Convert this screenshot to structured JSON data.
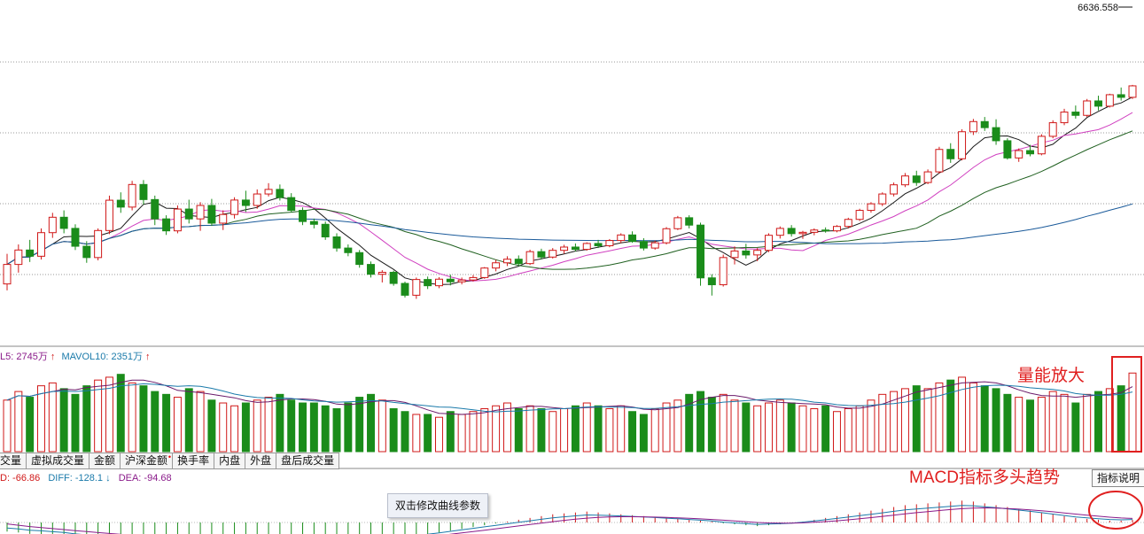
{
  "chart_data": {
    "type": "candlestick",
    "price_top_label": "6636.558",
    "volume_header": {
      "mavol5": "L5: 2745万",
      "mavol5_arrow": "↑",
      "mavol10": "MAVOL10: 2351万",
      "mavol10_arrow": "↑"
    },
    "macd_header": {
      "macd": "D: -66.86",
      "diff": "DIFF: -128.1",
      "diff_arrow": "↓",
      "dea": "DEA: -94.68"
    },
    "colors": {
      "up": "#d01818",
      "down": "#1a8c1a",
      "ma5": "#1a1a1a",
      "ma10": "#d040c0",
      "ma20": "#206020",
      "ma60": "#1a5a9a",
      "vol_ma5": "#6a1a6a",
      "vol_ma10": "#1a7aaa",
      "annotation": "#e02020"
    },
    "candles_note": "daily candles; O,H,L,C in index points",
    "candles": [
      [
        5021,
        5205,
        4982,
        5140
      ],
      [
        5140,
        5262,
        5090,
        5228
      ],
      [
        5228,
        5290,
        5155,
        5190
      ],
      [
        5190,
        5360,
        5170,
        5334
      ],
      [
        5334,
        5455,
        5302,
        5428
      ],
      [
        5428,
        5470,
        5330,
        5360
      ],
      [
        5360,
        5385,
        5228,
        5251
      ],
      [
        5251,
        5282,
        5150,
        5182
      ],
      [
        5182,
        5360,
        5165,
        5347
      ],
      [
        5347,
        5560,
        5325,
        5532
      ],
      [
        5532,
        5580,
        5455,
        5490
      ],
      [
        5490,
        5650,
        5470,
        5628
      ],
      [
        5628,
        5655,
        5505,
        5536
      ],
      [
        5536,
        5560,
        5380,
        5418
      ],
      [
        5418,
        5440,
        5320,
        5345
      ],
      [
        5345,
        5500,
        5330,
        5478
      ],
      [
        5478,
        5535,
        5390,
        5418
      ],
      [
        5418,
        5520,
        5345,
        5500
      ],
      [
        5500,
        5540,
        5375,
        5392
      ],
      [
        5392,
        5470,
        5350,
        5445
      ],
      [
        5445,
        5550,
        5420,
        5533
      ],
      [
        5533,
        5590,
        5460,
        5500
      ],
      [
        5500,
        5598,
        5480,
        5570
      ],
      [
        5570,
        5636,
        5555,
        5598
      ],
      [
        5598,
        5628,
        5530,
        5548
      ],
      [
        5548,
        5575,
        5458,
        5470
      ],
      [
        5470,
        5488,
        5380,
        5402
      ],
      [
        5402,
        5420,
        5360,
        5385
      ],
      [
        5385,
        5402,
        5290,
        5308
      ],
      [
        5308,
        5330,
        5218,
        5240
      ],
      [
        5240,
        5262,
        5190,
        5212
      ],
      [
        5212,
        5228,
        5120,
        5140
      ],
      [
        5140,
        5158,
        5060,
        5080
      ],
      [
        5080,
        5105,
        5030,
        5092
      ],
      [
        5092,
        5102,
        5010,
        5024
      ],
      [
        5024,
        5035,
        4938,
        4952
      ],
      [
        4952,
        5060,
        4930,
        5048
      ],
      [
        5048,
        5066,
        4990,
        5010
      ],
      [
        5010,
        5062,
        4995,
        5050
      ],
      [
        5050,
        5078,
        5012,
        5034
      ],
      [
        5034,
        5060,
        5018,
        5045
      ],
      [
        5045,
        5075,
        5036,
        5060
      ],
      [
        5060,
        5124,
        5052,
        5118
      ],
      [
        5118,
        5168,
        5098,
        5150
      ],
      [
        5150,
        5190,
        5130,
        5172
      ],
      [
        5172,
        5195,
        5132,
        5145
      ],
      [
        5145,
        5230,
        5136,
        5218
      ],
      [
        5218,
        5236,
        5170,
        5185
      ],
      [
        5185,
        5240,
        5176,
        5226
      ],
      [
        5226,
        5260,
        5206,
        5246
      ],
      [
        5246,
        5268,
        5220,
        5232
      ],
      [
        5232,
        5275,
        5224,
        5268
      ],
      [
        5268,
        5290,
        5240,
        5254
      ],
      [
        5254,
        5295,
        5245,
        5286
      ],
      [
        5286,
        5330,
        5270,
        5320
      ],
      [
        5320,
        5342,
        5272,
        5280
      ],
      [
        5280,
        5300,
        5225,
        5240
      ],
      [
        5240,
        5285,
        5230,
        5272
      ],
      [
        5272,
        5368,
        5262,
        5358
      ],
      [
        5358,
        5436,
        5350,
        5425
      ],
      [
        5425,
        5440,
        5360,
        5380
      ],
      [
        5380,
        5395,
        5010,
        5058
      ],
      [
        5058,
        5080,
        4950,
        5016
      ],
      [
        5016,
        5200,
        5005,
        5182
      ],
      [
        5182,
        5250,
        5140,
        5222
      ],
      [
        5222,
        5266,
        5175,
        5198
      ],
      [
        5198,
        5240,
        5160,
        5226
      ],
      [
        5226,
        5330,
        5215,
        5318
      ],
      [
        5318,
        5372,
        5298,
        5360
      ],
      [
        5360,
        5380,
        5310,
        5328
      ],
      [
        5328,
        5345,
        5296,
        5336
      ],
      [
        5336,
        5360,
        5318,
        5350
      ],
      [
        5350,
        5366,
        5334,
        5345
      ],
      [
        5345,
        5380,
        5336,
        5372
      ],
      [
        5372,
        5425,
        5360,
        5415
      ],
      [
        5415,
        5480,
        5405,
        5470
      ],
      [
        5470,
        5520,
        5456,
        5510
      ],
      [
        5510,
        5580,
        5496,
        5570
      ],
      [
        5570,
        5640,
        5555,
        5626
      ],
      [
        5626,
        5698,
        5612,
        5680
      ],
      [
        5680,
        5712,
        5620,
        5640
      ],
      [
        5640,
        5720,
        5630,
        5705
      ],
      [
        5705,
        5858,
        5695,
        5842
      ],
      [
        5842,
        5880,
        5760,
        5785
      ],
      [
        5785,
        5965,
        5775,
        5950
      ],
      [
        5950,
        6028,
        5930,
        6012
      ],
      [
        6012,
        6040,
        5955,
        5975
      ],
      [
        5975,
        6026,
        5870,
        5895
      ],
      [
        5895,
        5910,
        5780,
        5790
      ],
      [
        5790,
        5848,
        5766,
        5835
      ],
      [
        5835,
        5870,
        5800,
        5815
      ],
      [
        5815,
        5935,
        5806,
        5922
      ],
      [
        5922,
        6020,
        5910,
        6005
      ],
      [
        6005,
        6090,
        5990,
        6070
      ],
      [
        6070,
        6110,
        6030,
        6050
      ],
      [
        6050,
        6150,
        6040,
        6138
      ],
      [
        6138,
        6170,
        6080,
        6106
      ],
      [
        6106,
        6182,
        6098,
        6176
      ],
      [
        6176,
        6220,
        6140,
        6160
      ],
      [
        6160,
        6236,
        6150,
        6230
      ]
    ],
    "volumes_note": "volume in 万",
    "volumes": [
      1800,
      2100,
      1900,
      2300,
      2400,
      2200,
      2000,
      2300,
      2500,
      2600,
      2700,
      2400,
      2300,
      2100,
      2000,
      1900,
      2200,
      2100,
      1800,
      1700,
      1600,
      1700,
      1800,
      1900,
      2000,
      1800,
      1700,
      1700,
      1600,
      1500,
      1700,
      1900,
      2000,
      1800,
      1500,
      1400,
      1300,
      1300,
      1200,
      1400,
      1300,
      1400,
      1500,
      1600,
      1700,
      1500,
      1600,
      1500,
      1400,
      1500,
      1600,
      1700,
      1600,
      1500,
      1600,
      1400,
      1300,
      1500,
      1700,
      1800,
      2000,
      2100,
      1900,
      2000,
      1800,
      1700,
      1600,
      1700,
      1800,
      1700,
      1600,
      1500,
      1600,
      1400,
      1500,
      1600,
      1800,
      2000,
      2100,
      2200,
      2300,
      2200,
      2400,
      2500,
      2600,
      2400,
      2300,
      2200,
      2000,
      1900,
      1800,
      1900,
      2100,
      2000,
      1700,
      2000,
      2100,
      2200,
      2300,
      2745
    ],
    "macd_histogram": [
      -20,
      -22,
      -25,
      -26,
      -28,
      -30,
      -34,
      -36,
      -38,
      -40,
      -42,
      -44,
      -46,
      -48,
      -50,
      -52,
      -54,
      -55,
      -57,
      -58,
      -60,
      -62,
      -64,
      -65,
      -66,
      -64,
      -62,
      -60,
      -58,
      -56,
      -54,
      -50,
      -46,
      -42,
      -38,
      -34,
      -30,
      -26,
      -22,
      -18,
      -14,
      -10,
      -6,
      -2,
      2,
      6,
      10,
      14,
      18,
      20,
      22,
      24,
      22,
      20,
      18,
      16,
      14,
      12,
      10,
      8,
      6,
      4,
      2,
      -2,
      -4,
      -6,
      -8,
      -6,
      -4,
      -2,
      2,
      6,
      10,
      14,
      18,
      22,
      26,
      30,
      34,
      38,
      40,
      42,
      44,
      46,
      48,
      46,
      42,
      38,
      34,
      30,
      26,
      22,
      18,
      14,
      10,
      8,
      6,
      4,
      4,
      6
    ],
    "ylim_price": [
      4700,
      6700
    ]
  },
  "tabs": [
    {
      "label": "交量"
    },
    {
      "label": "虚拟成交量"
    },
    {
      "label": "金额"
    },
    {
      "label": "沪深金额",
      "marker": "•"
    },
    {
      "label": "换手率"
    },
    {
      "label": "内盘"
    },
    {
      "label": "外盘"
    },
    {
      "label": "盘后成交量"
    }
  ],
  "indicator_button": "指标说明",
  "tooltip": "双击修改曲线参数",
  "annotations": {
    "volume": "量能放大",
    "macd": "MACD指标多头趋势"
  }
}
